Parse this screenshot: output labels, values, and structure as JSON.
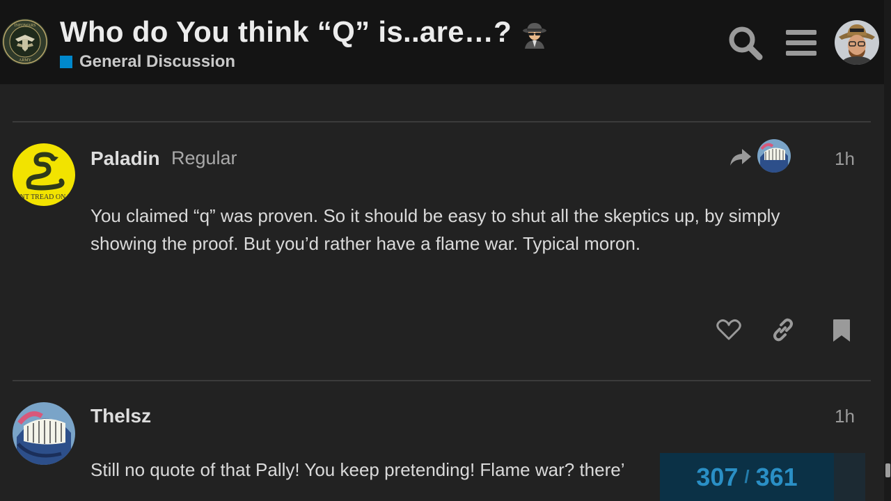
{
  "header": {
    "title": "Who do You think “Q” is..are…?",
    "title_icon": "spy-icon",
    "category": "General Discussion",
    "category_color": "#0088cc",
    "logo_text": "INFOWARS ARMY",
    "icons": [
      "search-icon",
      "hamburger-menu-icon",
      "user-avatar"
    ]
  },
  "posts": [
    {
      "username": "Paladin",
      "user_title": "Regular",
      "date": "1h",
      "avatar_text": "DONT TREAD ON ME",
      "body_lines": [
        "You claimed “q” was proven. So it should be easy to shut all the skeptics up, by simply",
        "showing the proof. But you’d rather have a flame war. Typical moron."
      ],
      "reply_to_icon": "reply-arrow-icon",
      "actions": [
        "heart-icon",
        "link-icon",
        "bookmark-icon"
      ]
    },
    {
      "username": "Thelsz",
      "date": "1h",
      "body_lines": [
        "Still no quote of that Pally! You keep pretending! Flame war? there’"
      ]
    }
  ],
  "timeline": {
    "current": "307",
    "separator": "/",
    "total": "361"
  },
  "colors": {
    "background": "#222222",
    "header": "#141414",
    "accent": "#0088cc",
    "timeline_bg": "#0b3146"
  }
}
